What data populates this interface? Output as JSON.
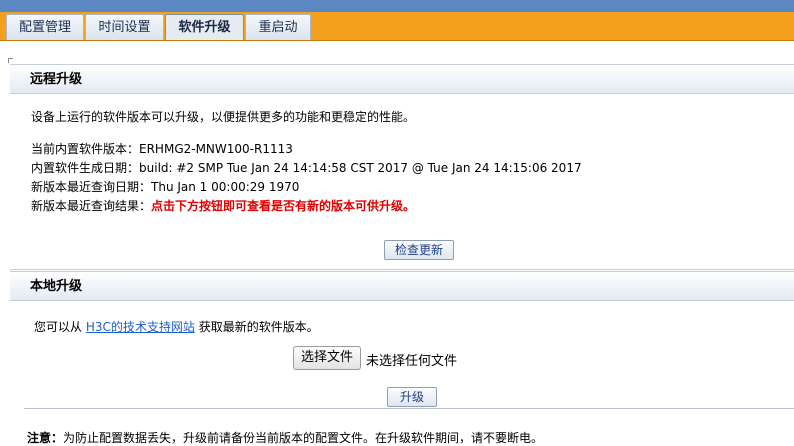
{
  "tabs": [
    {
      "label": "配置管理",
      "active": false
    },
    {
      "label": "时间设置",
      "active": false
    },
    {
      "label": "软件升级",
      "active": true
    },
    {
      "label": "重启动",
      "active": false
    }
  ],
  "remote": {
    "title": "远程升级",
    "description": "设备上运行的软件版本可以升级，以便提供更多的功能和更稳定的性能。",
    "current_version_label": "当前内置软件版本：",
    "current_version_value": "ERHMG2-MNW100-R1113",
    "build_date_label": "内置软件生成日期：",
    "build_date_value": "build: #2 SMP Tue Jan 24 14:14:58 CST 2017 @ Tue Jan 24 14:15:06 2017",
    "last_query_date_label": "新版本最近查询日期：",
    "last_query_date_value": "Thu Jan 1 00:00:29 1970",
    "last_query_result_label": "新版本最近查询结果：",
    "last_query_result_value": "点击下方按钮即可查看是否有新的版本可供升级。",
    "check_button": "检查更新"
  },
  "local": {
    "title": "本地升级",
    "hint_prefix": "您可以从",
    "hint_link": "H3C的技术支持网站",
    "hint_suffix": "获取最新的软件版本。",
    "choose_file_button": "选择文件",
    "no_file_text": "未选择任何文件",
    "upgrade_button": "升级"
  },
  "note": {
    "label": "注意：",
    "text": "为防止配置数据丢失，升级前请备份当前版本的配置文件。在升级软件期间，请不要断电。"
  },
  "colors": {
    "tabbar": "#f3a11c",
    "topstrip": "#5b87c3",
    "alert": "#e00000",
    "link": "#1a5fd0"
  }
}
